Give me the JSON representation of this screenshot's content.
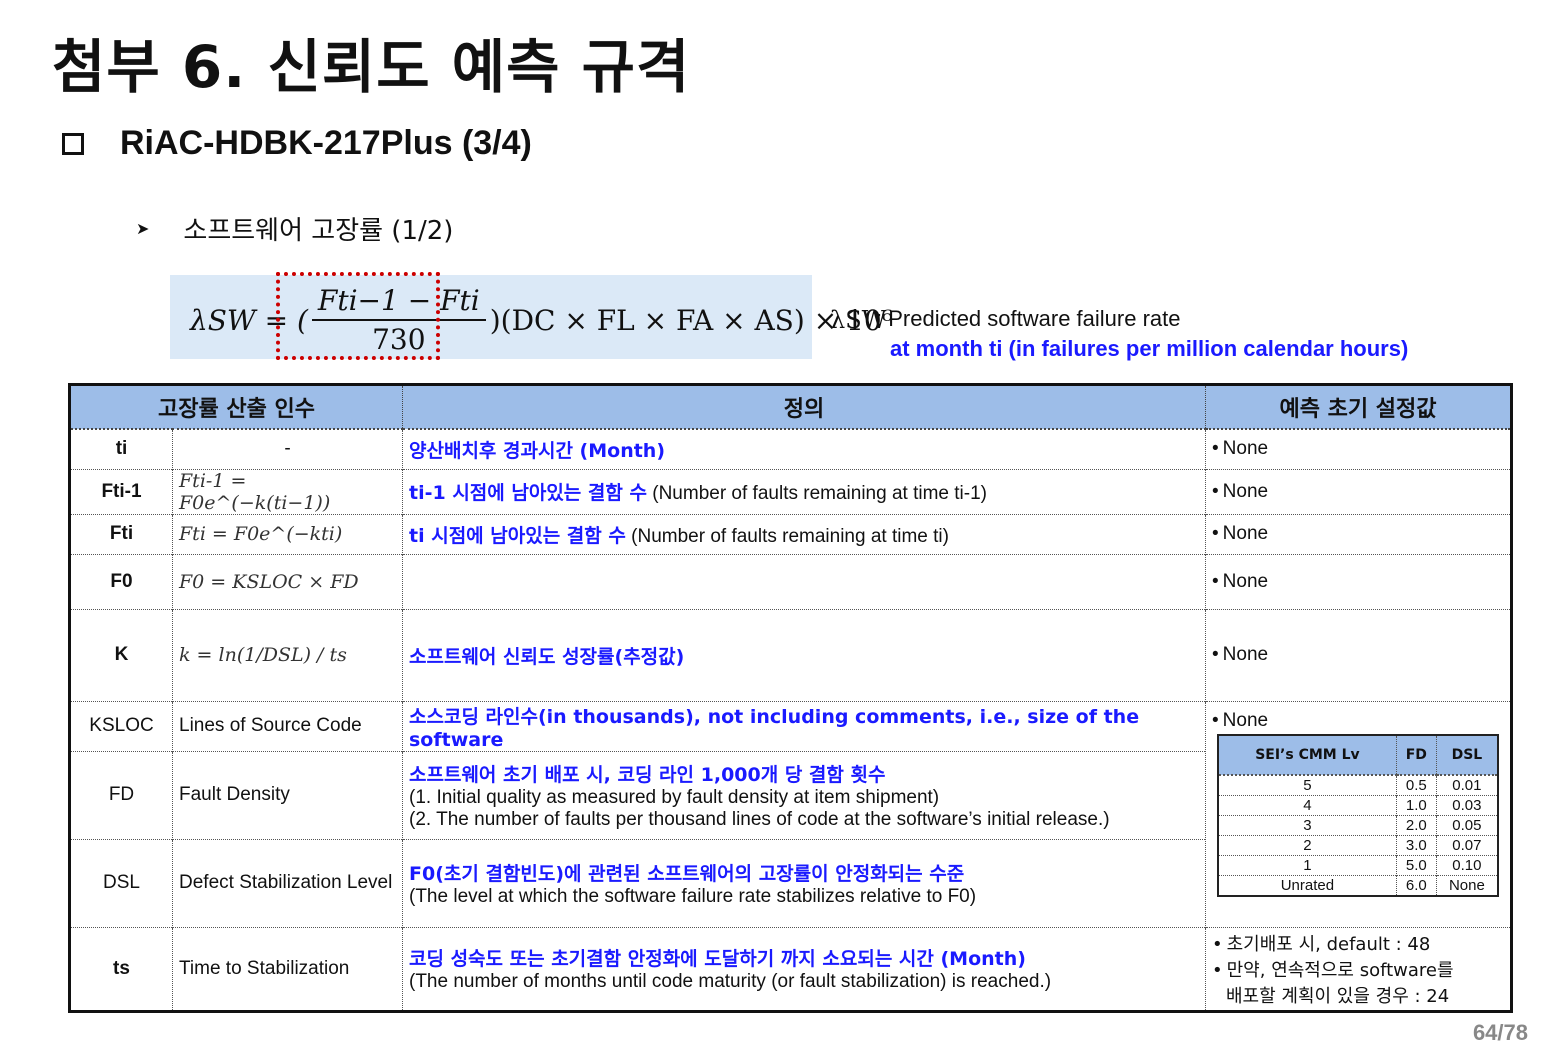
{
  "title": "첨부 6. 신뢰도 예측 규격",
  "subtitle": "RiAC-HDBK-217Plus (3/4)",
  "section": "소프트웨어 고장률 (1/2)",
  "formula": {
    "lhs": "λSW = (",
    "numerator": "Fti−1 − Fti",
    "denominator": "730",
    "rhs": ")(DC × FL × FA × AS) × 10⁶"
  },
  "legend": {
    "symbol": "λSW",
    "line1": ": Predicted software failure rate",
    "line2": "at month ti (in failures per million calendar hours)"
  },
  "table": {
    "headers": [
      "고장률 산출 인수",
      "정의",
      "예측 초기 설정값"
    ],
    "rows": [
      {
        "sym": "ti",
        "eq": "-",
        "def_blue": "양산배치후 경과시간 (Month)",
        "def_plain": "",
        "init": "None"
      },
      {
        "sym": "Fti-1",
        "eq": "Fti-1 = F0e^(−k(ti−1))",
        "def_blue": "ti-1 시점에 남아있는 결함 수",
        "def_plain": "(Number of faults remaining at time ti-1)",
        "init": "None"
      },
      {
        "sym": "Fti",
        "eq": "Fti = F0e^(−kti)",
        "def_blue": "ti 시점에 남아있는 결함 수",
        "def_plain": "(Number of faults remaining at time ti)",
        "init": "None"
      },
      {
        "sym": "F0",
        "eq": "F0 = KSLOC × FD",
        "def_blue": "",
        "def_plain": "",
        "init": "None"
      },
      {
        "sym": "K",
        "eq": "k = ln(1/DSL) / ts",
        "def_blue": "소프트웨어 신뢰도 성장률(추정값)",
        "def_plain": "",
        "init": "None"
      },
      {
        "sym": "KSLOC",
        "eq": "Lines of Source Code",
        "def_blue": "소스코딩 라인수(in thousands), not including comments, i.e., size of the software",
        "def_plain": "",
        "init": "None"
      },
      {
        "sym": "FD",
        "eq": "Fault Density",
        "def_blue": "소프트웨어 초기 배포 시, 코딩 라인 1,000개 당 결함 횟수",
        "def_plain": "(1. Initial quality as measured by fault density at item shipment)",
        "def_plain2": "(2. The number of faults per thousand lines of code at the software’s initial release.)"
      },
      {
        "sym": "DSL",
        "eq": "Defect Stabilization Level",
        "def_blue": "F0(초기 결함빈도)에 관련된 소프트웨어의 고장률이 안정화되는 수준",
        "def_plain": "(The level at which the software failure rate stabilizes relative to F0)"
      },
      {
        "sym": "ts",
        "eq": "Time to Stabilization",
        "def_blue": "코딩 성숙도 또는 초기결함 안정화에 도달하기 까지 소요되는 시간 (Month)",
        "def_plain": "(The number of months until code maturity (or fault stabilization) is reached.)",
        "init1": "초기배포 시, default : 48",
        "init2": "만약, 연속적으로 software를",
        "init3": "배포할 계획이 있을 경우 : 24"
      }
    ]
  },
  "sei": {
    "headers": [
      "SEI’s CMM Lv",
      "FD",
      "DSL"
    ],
    "rows": [
      [
        "5",
        "0.5",
        "0.01"
      ],
      [
        "4",
        "1.0",
        "0.03"
      ],
      [
        "3",
        "2.0",
        "0.05"
      ],
      [
        "2",
        "3.0",
        "0.07"
      ],
      [
        "1",
        "5.0",
        "0.10"
      ],
      [
        "Unrated",
        "6.0",
        "None"
      ]
    ]
  },
  "page": "64/78"
}
